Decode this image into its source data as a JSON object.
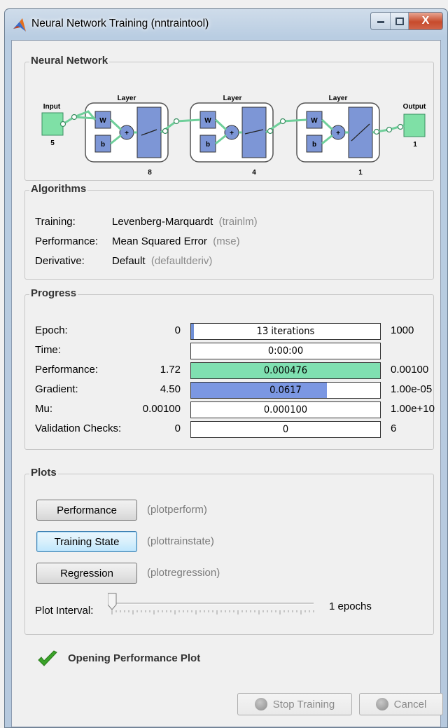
{
  "window": {
    "title": "Neural Network Training (nntraintool)",
    "close_glyph": "X"
  },
  "network": {
    "section_title": "Neural Network",
    "input_label": "Input",
    "input_size": "5",
    "output_label": "Output",
    "output_size": "1",
    "layers": [
      {
        "title": "Layer",
        "w": "W",
        "b": "b",
        "sum": "+",
        "size": "8"
      },
      {
        "title": "Layer",
        "w": "W",
        "b": "b",
        "sum": "+",
        "size": "4"
      },
      {
        "title": "Layer",
        "w": "W",
        "b": "b",
        "sum": "+",
        "size": "1"
      }
    ],
    "colors": {
      "io": "#7fe0a6",
      "block": "#7d96d6",
      "link": "#6fcf9a"
    }
  },
  "algorithms": {
    "section_title": "Algorithms",
    "rows": [
      {
        "label": "Training:",
        "value": "Levenberg-Marquardt",
        "code": "(trainlm)"
      },
      {
        "label": "Performance:",
        "value": "Mean Squared Error",
        "code": "(mse)"
      },
      {
        "label": "Derivative:",
        "value": "Default",
        "code": "(defaultderiv)"
      }
    ]
  },
  "progress": {
    "section_title": "Progress",
    "rows": [
      {
        "label": "Epoch:",
        "start": "0",
        "current": "13 iterations",
        "end": "1000",
        "fill": 0.013,
        "fill_color": "#6f8fd6"
      },
      {
        "label": "Time:",
        "start": "",
        "current": "0:00:00",
        "end": "",
        "fill": 0,
        "fill_color": "#ffffff"
      },
      {
        "label": "Performance:",
        "start": "1.72",
        "current": "0.000476",
        "end": "0.00100",
        "fill": 1.0,
        "fill_color": "#7fe0b1"
      },
      {
        "label": "Gradient:",
        "start": "4.50",
        "current": "0.0617",
        "end": "1.00e-05",
        "fill": 0.72,
        "fill_color": "#7b97e2"
      },
      {
        "label": "Mu:",
        "start": "0.00100",
        "current": "0.000100",
        "end": "1.00e+10",
        "fill": 0,
        "fill_color": "#ffffff"
      },
      {
        "label": "Validation Checks:",
        "start": "0",
        "current": "0",
        "end": "6",
        "fill": 0,
        "fill_color": "#ffffff"
      }
    ]
  },
  "plots": {
    "section_title": "Plots",
    "buttons": [
      {
        "label": "Performance",
        "code": "(plotperform)",
        "focused": false
      },
      {
        "label": "Training State",
        "code": "(plottrainstate)",
        "focused": true
      },
      {
        "label": "Regression",
        "code": "(plotregression)",
        "focused": false
      }
    ],
    "interval_label": "Plot Interval:",
    "interval_value": "1 epochs",
    "interval_fraction": 0
  },
  "status": {
    "text": "Opening Performance Plot",
    "icon": "checkmark-icon",
    "color": "#3aa329"
  },
  "footer": {
    "stop_label": "Stop Training",
    "cancel_label": "Cancel"
  }
}
